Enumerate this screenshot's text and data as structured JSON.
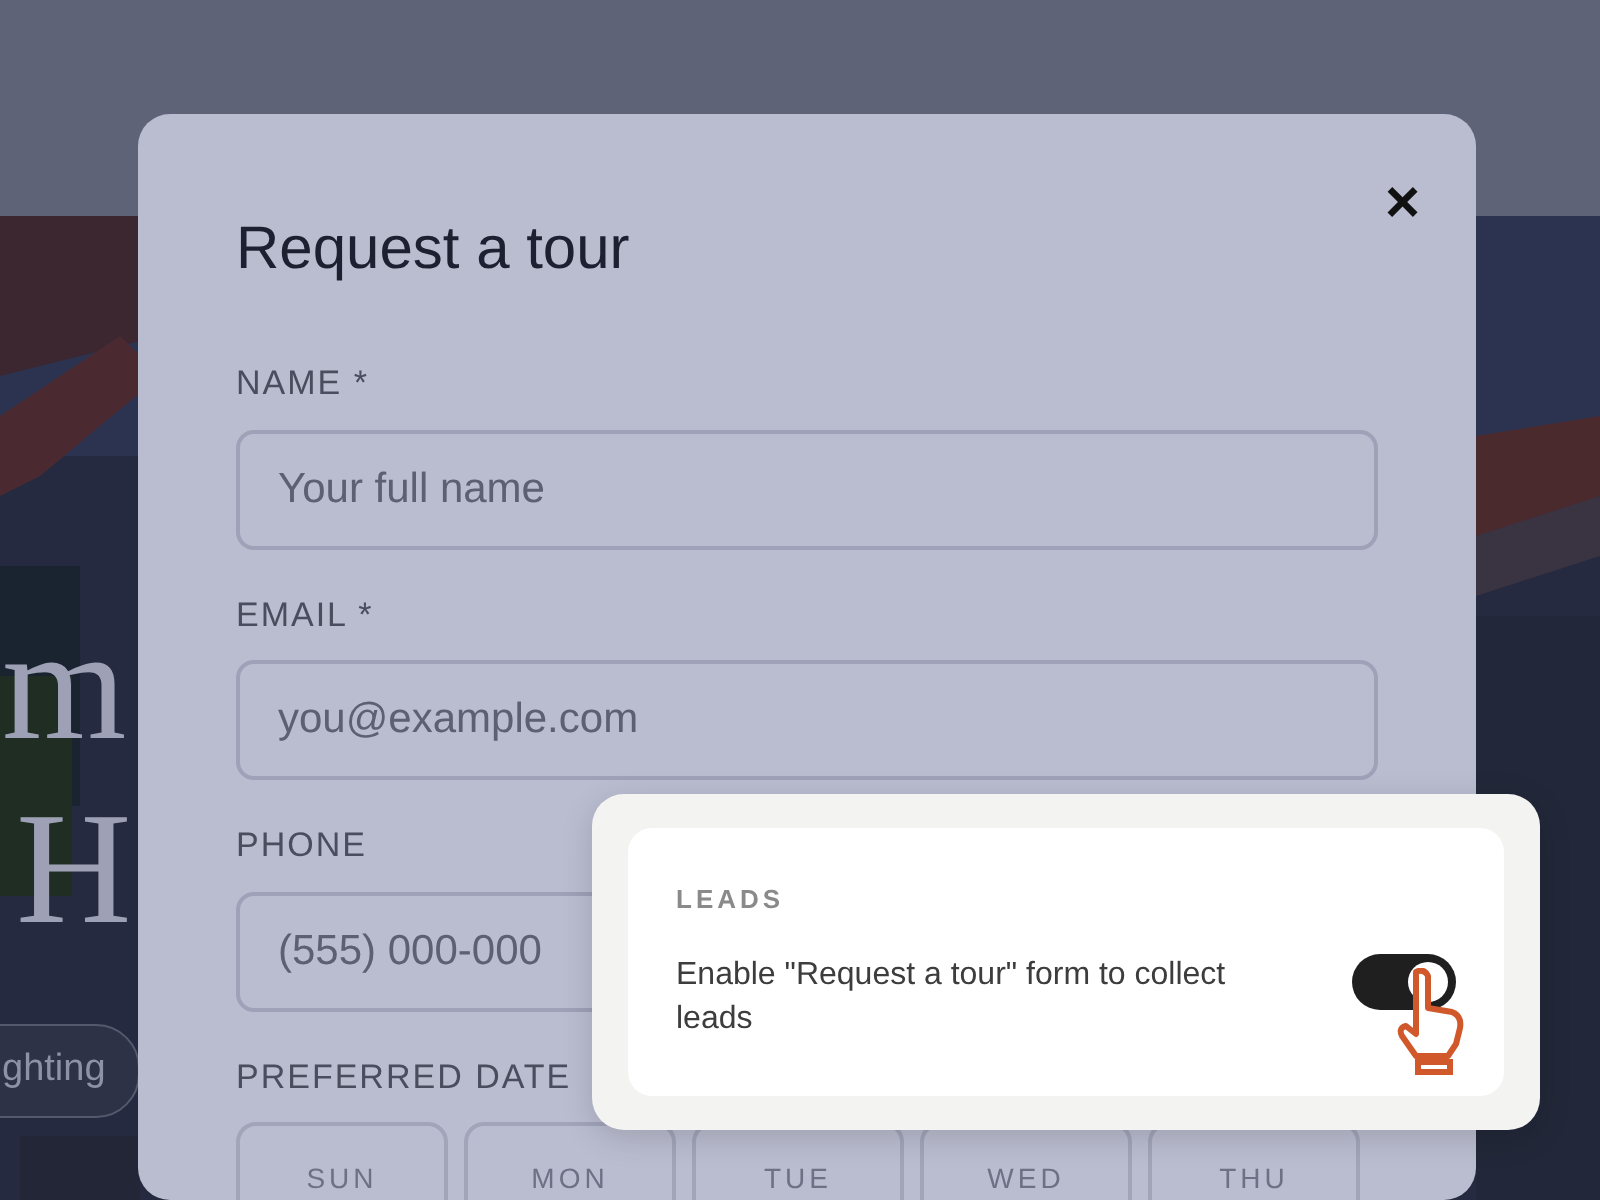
{
  "background": {
    "hero_lines": [
      "m",
      "H"
    ],
    "chip": "ghting"
  },
  "modal": {
    "title": "Request a tour",
    "close": "×",
    "fields": [
      {
        "label": "NAME *",
        "placeholder": "Your full name"
      },
      {
        "label": "EMAIL *",
        "placeholder": "you@example.com"
      },
      {
        "label": "PHONE",
        "placeholder": "(555) 000-000"
      }
    ],
    "date_label": "PREFERRED DATE",
    "days": [
      "SUN",
      "MON",
      "TUE",
      "WED",
      "THU"
    ]
  },
  "popup": {
    "heading": "LEADS",
    "text": "Enable \"Request a tour\" form to collect leads",
    "enabled": true
  }
}
